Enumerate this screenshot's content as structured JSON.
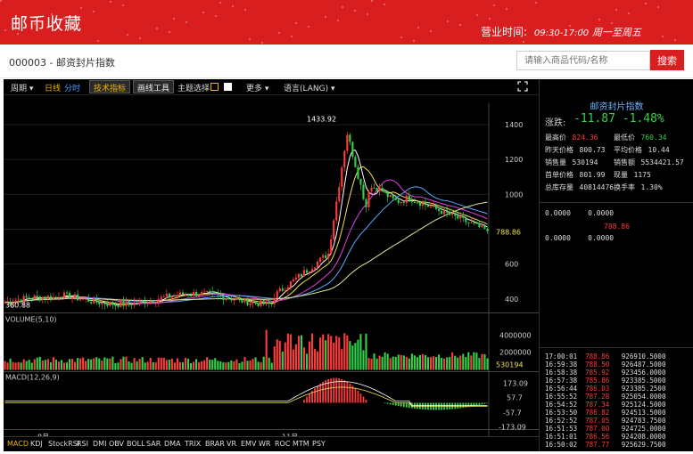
{
  "banner": {
    "brand": "邮币收藏",
    "hours_label": "营业时间:",
    "hours_time": "09:30-17:00",
    "hours_days": "周一至周五"
  },
  "subheader": {
    "breadcrumb": "000003 - 邮资封片指数",
    "search_placeholder": "请输入商品代码/名称",
    "search_button": "搜索"
  },
  "toolbar": {
    "items": [
      "周期 ▾",
      "日线",
      "分时",
      "技术指标",
      "画线工具",
      "主题选择",
      "更多 ▾",
      "语言(LANG) ▾"
    ],
    "fullscreen_icon": "expand-icon",
    "theme_colors": [
      "#000000",
      "#ffffff"
    ]
  },
  "side_panel": {
    "title": "邮资封片指数",
    "change_label": "涨跌:",
    "change_value": "-11.87  -1.48%",
    "rows": [
      [
        "最高价",
        "824.36",
        "最低价",
        "760.34"
      ],
      [
        "昨天价格",
        "800.73",
        "平均价格",
        "10.44"
      ],
      [
        "销售量",
        "530194",
        "销售额",
        "5534421.57"
      ],
      [
        "首单价格",
        "801.99",
        "现量",
        "1175"
      ],
      [
        "总库存量",
        "40814476",
        "换手率",
        "1.30%"
      ]
    ],
    "book": [
      [
        "0.0000",
        "0.0000"
      ],
      [
        "0.0000",
        "0.0000"
      ]
    ],
    "book_price": "788.86",
    "trades": [
      [
        "17:00:01",
        "788.86",
        "926910.5000"
      ],
      [
        "16:59:38",
        "788.50",
        "926487.5000"
      ],
      [
        "16:58:38",
        "785.92",
        "923456.0000"
      ],
      [
        "16:57:38",
        "785.86",
        "923385.5000"
      ],
      [
        "16:56:44",
        "786.03",
        "923385.2500"
      ],
      [
        "16:55:52",
        "787.28",
        "925054.0000"
      ],
      [
        "16:54:52",
        "787.34",
        "925124.5000"
      ],
      [
        "16:53:50",
        "786.82",
        "924513.5000"
      ],
      [
        "16:52:52",
        "787.05",
        "924783.7500"
      ],
      [
        "16:51:53",
        "787.00",
        "924725.0000"
      ],
      [
        "16:51:01",
        "786.56",
        "924208.0000"
      ],
      [
        "16:50:02",
        "787.77",
        "925629.7500"
      ]
    ]
  },
  "bottom_indicators": [
    "MACD",
    "KDJ",
    "StockRSI",
    "RSI",
    "DMI",
    "OBV",
    "BOLL",
    "SAR",
    "DMA",
    "TRIX",
    "BRAR",
    "VR",
    "EMV",
    "WR",
    "ROC",
    "MTM",
    "PSY"
  ],
  "chart_data": {
    "type": "candlestick",
    "price_axis": {
      "ticks": [
        1400,
        1200,
        1000,
        800,
        600,
        400
      ],
      "ylim": [
        340,
        1500
      ]
    },
    "annotations": {
      "high": "1433.92",
      "low": "360.88",
      "last": "788.86"
    },
    "volume_panel": {
      "label": "VOLUME(5,10)",
      "ticks": [
        "4000000",
        "2000000"
      ],
      "last": "530194"
    },
    "macd_panel": {
      "label": "MACD(12,26,9)",
      "ticks": [
        "173.09",
        "57.7",
        "-57.7",
        "-173.09"
      ]
    },
    "x_ticks": [
      "8月",
      "11月"
    ],
    "colors": {
      "up": "#ff3b3b",
      "down": "#32d24a",
      "ma5": "#ffffff",
      "ma10": "#f0e050",
      "ma20": "#e040e0",
      "ma30": "#5aa8ff",
      "ma60": "#d8e89a"
    }
  }
}
